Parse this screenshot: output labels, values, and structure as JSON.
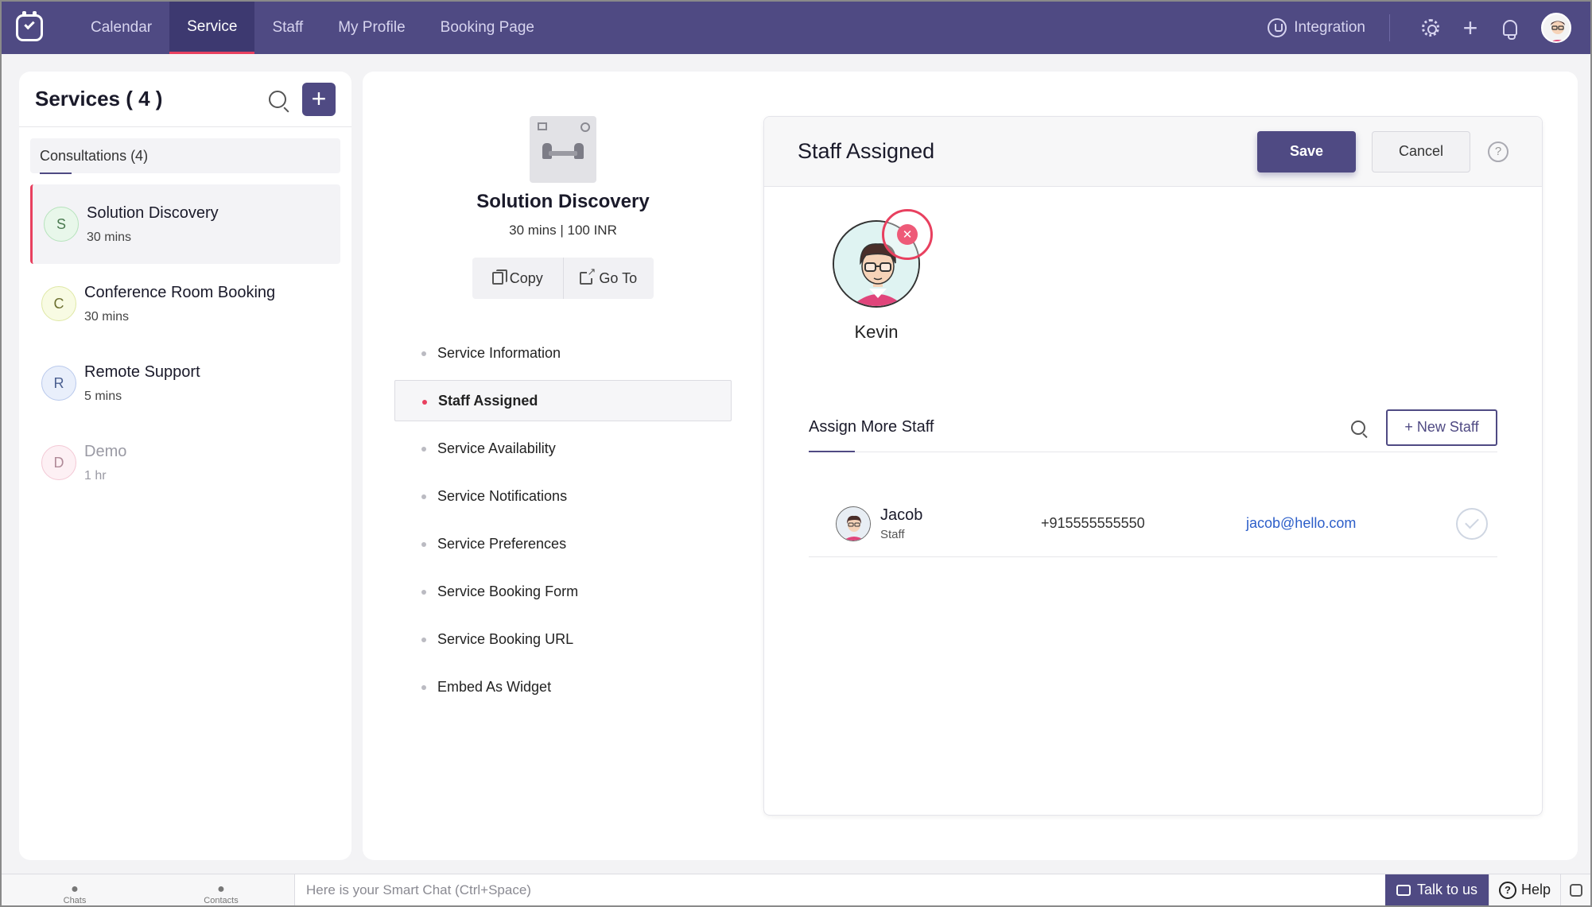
{
  "nav": {
    "tabs": [
      {
        "label": "Calendar"
      },
      {
        "label": "Service"
      },
      {
        "label": "Staff"
      },
      {
        "label": "My Profile"
      },
      {
        "label": "Booking Page"
      }
    ],
    "integration_label": "Integration",
    "icons": [
      "integration-icon",
      "settings-gear-icon",
      "add-plus-icon",
      "notification-bell-icon",
      "user-avatar"
    ]
  },
  "services_panel": {
    "title": "Services ( 4 )",
    "add_symbol": "+",
    "group_label": "Consultations (4)",
    "items": [
      {
        "initial": "S",
        "name": "Solution Discovery",
        "duration": "30 mins",
        "badge_color": "#e8f7ea",
        "badge_border": "#b6e3bc"
      },
      {
        "initial": "C",
        "name": "Conference Room Booking",
        "duration": "30 mins",
        "badge_color": "#f8fbe3",
        "badge_border": "#dfe8a6"
      },
      {
        "initial": "R",
        "name": "Remote Support",
        "duration": "5 mins",
        "badge_color": "#e9effb",
        "badge_border": "#b9c9ec"
      },
      {
        "initial": "D",
        "name": "Demo",
        "duration": "1 hr",
        "badge_color": "#fdf0f4",
        "badge_border": "#f3c8d5"
      }
    ]
  },
  "service_detail": {
    "title": "Solution Discovery",
    "meta": "30 mins | 100 INR",
    "copy_label": "Copy",
    "goto_label": "Go To",
    "menu": [
      {
        "label": "Service Information"
      },
      {
        "label": "Staff Assigned"
      },
      {
        "label": "Service Availability"
      },
      {
        "label": "Service Notifications"
      },
      {
        "label": "Service Preferences"
      },
      {
        "label": "Service Booking Form"
      },
      {
        "label": "Service Booking URL"
      },
      {
        "label": "Embed As Widget"
      }
    ]
  },
  "staff_card": {
    "title": "Staff Assigned",
    "save_label": "Save",
    "cancel_label": "Cancel",
    "help_symbol": "?",
    "assigned": {
      "name": "Kevin",
      "remove_symbol": "✕"
    },
    "assign_more_title": "Assign More Staff",
    "new_staff_label": "+ New Staff",
    "rows": [
      {
        "name": "Jacob",
        "role": "Staff",
        "phone": "+915555555550",
        "email": "jacob@hello.com"
      }
    ]
  },
  "bottom_bar": {
    "chats_label": "Chats",
    "contacts_label": "Contacts",
    "smart_chat_placeholder": "Here is your Smart Chat (Ctrl+Space)",
    "talk_label": "Talk to us",
    "help_label": "Help",
    "help_symbol": "?"
  },
  "colors": {
    "brand": "#4f4a83",
    "accent": "#e8405f",
    "link": "#2c5ec9"
  }
}
